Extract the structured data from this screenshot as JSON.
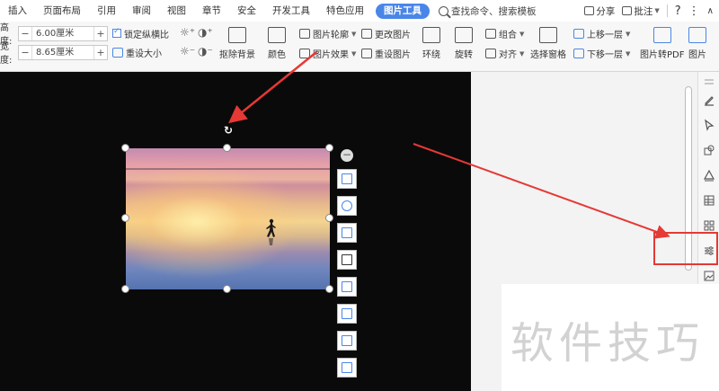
{
  "tabs": [
    {
      "label": "插入"
    },
    {
      "label": "页面布局"
    },
    {
      "label": "引用"
    },
    {
      "label": "审阅"
    },
    {
      "label": "视图"
    },
    {
      "label": "章节"
    },
    {
      "label": "安全"
    },
    {
      "label": "开发工具"
    },
    {
      "label": "特色应用"
    },
    {
      "label": "图片工具",
      "active": true
    }
  ],
  "search": {
    "label": "查找命令、搜索模板"
  },
  "topbar_right": {
    "share": "分享",
    "comment": "批注",
    "help": "?"
  },
  "ribbon": {
    "height_label": "高度:",
    "height_value": "6.00厘米",
    "width_label": "宽度:",
    "width_value": "8.65厘米",
    "lock_ratio": "锁定纵横比",
    "reset_size": "重设大小",
    "remove_bg": "抠除背景",
    "color": "颜色",
    "outline": "图片轮廓",
    "effect": "图片效果",
    "change_pic": "更改图片",
    "reset_pic": "重设图片",
    "wrap": "环绕",
    "rotate": "旋转",
    "group": "组合",
    "align": "对齐",
    "select_pane": "选择窗格",
    "bring_forward": "上移一层",
    "send_backward": "下移一层",
    "pic_to_pdf": "图片转PDF",
    "pic_more": "图片"
  },
  "watermark": {
    "text": "软件技巧"
  },
  "colors": {
    "accent": "#4a86e8",
    "highlight": "#e53935",
    "canvas": "#0a0a0a"
  },
  "sidebar_icons": [
    "pen-icon",
    "cursor-icon",
    "shapes-icon",
    "fill-icon",
    "table-icon",
    "grid-icon",
    "adjust-icon",
    "image-icon"
  ]
}
